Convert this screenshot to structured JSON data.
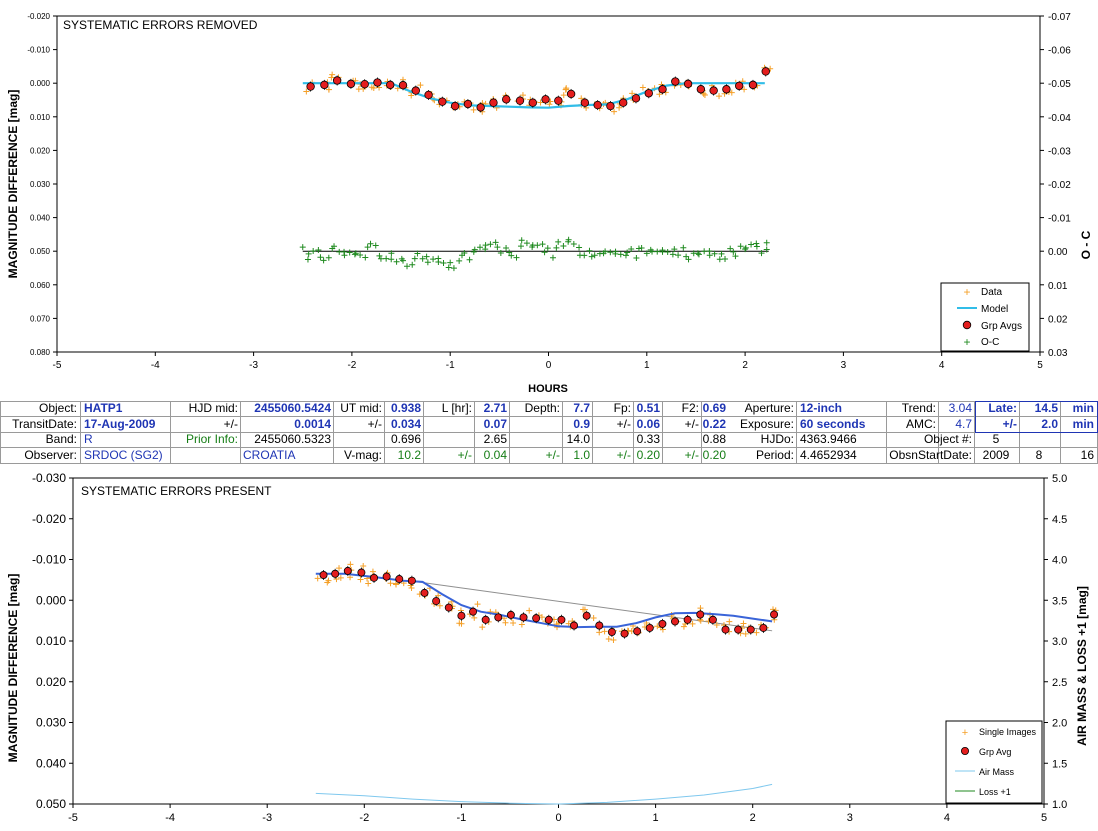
{
  "chart_data": [
    {
      "type": "scatter",
      "title": "SYSTEMATIC ERRORS REMOVED",
      "xlabel": "HOURS",
      "ylabel": "MAGNITUDE DIFFERENCE [mag]",
      "y2label": "O - C",
      "xlim": [
        -5,
        5
      ],
      "ylim": [
        -0.02,
        0.08
      ],
      "y2lim": [
        -0.07,
        0.03
      ],
      "y_reversed": true,
      "y2_reversed": true,
      "x_ticks": [
        "-5",
        "-4",
        "-3",
        "-2",
        "-1",
        "0",
        "1",
        "2",
        "3",
        "4",
        "5"
      ],
      "y_ticks": [
        "-0.020",
        "-0.010",
        "0.000",
        "0.010",
        "0.020",
        "0.030",
        "0.040",
        "0.050",
        "0.060",
        "0.070",
        "0.080"
      ],
      "y2_ticks": [
        "-0.07",
        "-0.06",
        "-0.05",
        "-0.04",
        "-0.03",
        "-0.02",
        "-0.01",
        "0.00",
        "0.01",
        "0.02",
        "0.03"
      ],
      "legend": [
        "Data",
        "Model",
        "Grp Avgs",
        "O-C"
      ],
      "legend_position": "bottom-right",
      "colors": {
        "data": "#f5a028",
        "model": "#31bde8",
        "grp": "#e41e1e",
        "oc": "#1f8a1f"
      },
      "model": {
        "x": [
          -2.5,
          -2.2,
          -1.9,
          -1.6,
          -1.4,
          -1.2,
          -1.0,
          -0.8,
          -0.6,
          -0.4,
          -0.2,
          0.0,
          0.2,
          0.4,
          0.6,
          0.8,
          1.0,
          1.2,
          1.4,
          1.6,
          1.8,
          2.0,
          2.2
        ],
        "y": [
          0.0,
          0.0,
          0.0,
          0.0,
          0.0025,
          0.0045,
          0.0058,
          0.0066,
          0.0068,
          0.007,
          0.0072,
          0.0073,
          0.0068,
          0.0065,
          0.0063,
          0.0048,
          0.0025,
          0.0007,
          0.0,
          0.0,
          0.0,
          0.0,
          0.0
        ]
      },
      "grp_avgs": {
        "x": [
          -2.42,
          -2.28,
          -2.15,
          -2.01,
          -1.87,
          -1.74,
          -1.61,
          -1.48,
          -1.35,
          -1.22,
          -1.08,
          -0.95,
          -0.82,
          -0.69,
          -0.56,
          -0.43,
          -0.29,
          -0.16,
          -0.03,
          0.1,
          0.23,
          0.37,
          0.5,
          0.63,
          0.76,
          0.89,
          1.02,
          1.16,
          1.29,
          1.42,
          1.55,
          1.68,
          1.81,
          1.94,
          2.08,
          2.21
        ],
        "y": [
          0.001,
          0.0005,
          -0.0008,
          0.0002,
          0.0003,
          -0.0002,
          0.0005,
          0.0006,
          0.0022,
          0.0035,
          0.0055,
          0.0068,
          0.0062,
          0.0072,
          0.0058,
          0.0048,
          0.0052,
          0.0058,
          0.0048,
          0.0052,
          0.0032,
          0.0058,
          0.0065,
          0.0068,
          0.0058,
          0.0045,
          0.003,
          0.0018,
          -0.0005,
          0.0002,
          0.0018,
          0.0022,
          0.0018,
          0.0008,
          0.0005,
          -0.0035
        ]
      },
      "oc": {
        "x": [
          -2.44,
          -2.32,
          -2.2,
          -2.08,
          -1.96,
          -1.84,
          -1.72,
          -1.6,
          -1.48,
          -1.36,
          -1.24,
          -1.12,
          -1.0,
          -0.88,
          -0.76,
          -0.64,
          -0.52,
          -0.4,
          -0.28,
          -0.16,
          -0.04,
          0.08,
          0.2,
          0.32,
          0.44,
          0.56,
          0.68,
          0.8,
          0.92,
          1.04,
          1.16,
          1.28,
          1.4,
          1.52,
          1.64,
          1.76,
          1.88,
          2.0,
          2.12,
          2.22
        ],
        "y": [
          0.0008,
          0.0018,
          -0.0008,
          0.0002,
          0.0006,
          -0.0012,
          0.0014,
          0.0024,
          0.0028,
          0.0022,
          0.0016,
          0.0032,
          0.0034,
          0.0012,
          0.0002,
          -0.0018,
          -0.0012,
          0.0004,
          -0.0015,
          -0.0018,
          0.0003,
          -0.001,
          -0.0028,
          0.0012,
          0.0016,
          0.0006,
          0.0008,
          0.0004,
          -0.0008,
          -0.0004,
          0.0002,
          -0.0006,
          0.0016,
          0.0006,
          0.0012,
          0.0008,
          0.0002,
          -0.0006,
          -0.0014,
          -0.0005
        ]
      }
    },
    {
      "type": "scatter",
      "title": "SYSTEMATIC ERRORS PRESENT",
      "ylabel": "MAGNITUDE DIFFERENCE [mag]",
      "y2label": "AIR MASS & LOSS +1 [mag]",
      "xlim": [
        -5,
        5
      ],
      "ylim": [
        -0.03,
        0.05
      ],
      "y2lim": [
        1.0,
        5.0
      ],
      "y_reversed": true,
      "x_ticks": [
        "-5",
        "-4",
        "-3",
        "-2",
        "-1",
        "0",
        "1",
        "2",
        "3",
        "4",
        "5"
      ],
      "y_ticks": [
        "-0.030",
        "-0.020",
        "-0.010",
        "0.000",
        "0.010",
        "0.020",
        "0.030",
        "0.040",
        "0.050"
      ],
      "y2_ticks": [
        "5.0",
        "4.5",
        "4.0",
        "3.5",
        "3.0",
        "2.5",
        "2.0",
        "1.5",
        "1.0"
      ],
      "legend": [
        "Single Images",
        "Grp Avg",
        "Air Mass",
        "Loss +1"
      ],
      "legend_position": "bottom-right",
      "colors": {
        "single": "#f5a028",
        "grp": "#e41e1e",
        "model": "#3a64d8",
        "trend": "#8f8f8f",
        "airmass": "#7fc8ee",
        "loss": "#1f8a1f"
      },
      "model": {
        "x": [
          -2.5,
          -2.2,
          -1.9,
          -1.6,
          -1.4,
          -1.2,
          -1.0,
          -0.8,
          -0.6,
          -0.4,
          -0.2,
          0.0,
          0.2,
          0.4,
          0.6,
          0.8,
          1.0,
          1.2,
          1.4,
          1.6,
          1.8,
          2.0,
          2.2
        ],
        "y": [
          -0.0065,
          -0.0065,
          -0.0057,
          -0.0048,
          -0.0045,
          -0.0015,
          0.0012,
          0.0028,
          0.0036,
          0.0046,
          0.0055,
          0.0064,
          0.0066,
          0.0065,
          0.0065,
          0.0056,
          0.0042,
          0.0032,
          0.0031,
          0.0034,
          0.0038,
          0.0045,
          0.0052
        ]
      },
      "trend_line": {
        "x": [
          -1.45,
          2.2
        ],
        "y": [
          -0.0045,
          0.0075
        ]
      },
      "grp_avgs": {
        "x": [
          -2.42,
          -2.3,
          -2.17,
          -2.03,
          -1.9,
          -1.77,
          -1.64,
          -1.51,
          -1.38,
          -1.26,
          -1.13,
          -1.0,
          -0.88,
          -0.75,
          -0.62,
          -0.49,
          -0.36,
          -0.23,
          -0.1,
          0.03,
          0.16,
          0.29,
          0.42,
          0.55,
          0.68,
          0.81,
          0.94,
          1.07,
          1.2,
          1.33,
          1.46,
          1.59,
          1.72,
          1.85,
          1.98,
          2.11,
          2.22
        ],
        "y": [
          -0.0062,
          -0.0065,
          -0.0072,
          -0.0068,
          -0.0055,
          -0.0058,
          -0.0052,
          -0.0048,
          -0.0018,
          0.0002,
          0.0018,
          0.0038,
          0.0028,
          0.0048,
          0.0042,
          0.0036,
          0.0042,
          0.0044,
          0.0048,
          0.0048,
          0.0062,
          0.0038,
          0.0062,
          0.0078,
          0.0082,
          0.0076,
          0.0068,
          0.0058,
          0.0052,
          0.0048,
          0.0035,
          0.0048,
          0.0072,
          0.0072,
          0.0072,
          0.0068,
          0.0035
        ]
      },
      "airmass": {
        "x": [
          -2.5,
          -2.0,
          -1.5,
          -1.0,
          -0.5,
          0.0,
          0.5,
          1.0,
          1.5,
          2.0,
          2.2
        ],
        "y": [
          1.13,
          1.1,
          1.06,
          1.03,
          1.01,
          1.0,
          1.02,
          1.06,
          1.11,
          1.19,
          1.24
        ]
      }
    }
  ],
  "info": {
    "row1": {
      "object_label": "Object:",
      "object": "HATP1",
      "hjd_mid_label": "HJD mid:",
      "hjd_mid": "2455060.5424",
      "ut_mid_label": "UT mid:",
      "ut_mid": "0.938",
      "l_hr_label": "L [hr]:",
      "l_hr": "2.71",
      "depth_label": "Depth:",
      "depth": "7.7",
      "fp_label": "Fp:",
      "fp": "0.51",
      "f2_label": "F2:",
      "f2": "0.69",
      "aperture_label": "Aperture:",
      "aperture": "12-inch",
      "trend_label": "Trend:",
      "trend": "3.04",
      "late_label": "Late:",
      "late": "14.5",
      "late_unit": "min"
    },
    "row2": {
      "transit_date_label": "TransitDate:",
      "transit_date": "17-Aug-2009",
      "pm1": "+/-",
      "hjd_err": "0.0014",
      "pm2": "+/-",
      "ut_err": "0.034",
      "l_err": "0.07",
      "depth_err": "0.9",
      "pm3": "+/-",
      "fp_err": "0.06",
      "pm4": "+/-",
      "f2_err": "0.22",
      "exposure_label": "Exposure:",
      "exposure": "60 seconds",
      "amc_label": "AMC:",
      "amc": "4.7",
      "pm5": "+/-",
      "late_err": "2.0",
      "late_err_unit": "min"
    },
    "row3": {
      "band_label": "Band:",
      "band": "R",
      "prior_label": "Prior Info:",
      "prior_hjd": "2455060.5323",
      "prior_ut": "0.696",
      "prior_l": "2.65",
      "prior_depth": "14.0",
      "prior_fp": "0.33",
      "prior_f2": "0.88",
      "hjdo_label": "HJDo:",
      "hjdo": "4363.9466",
      "object_num_label": "Object #:",
      "object_num": "5"
    },
    "row4": {
      "observer_label": "Observer:",
      "observer": "SRDOC (SG2)",
      "country": "CROATIA",
      "vmag_label": "V-mag:",
      "vmag": "10.2",
      "pm6": "+/-",
      "e1": "0.04",
      "pm7": "+/-",
      "e2": "1.0",
      "pm8": "+/-",
      "e3": "0.20",
      "pm9": "+/-",
      "e4": "0.20",
      "period_label": "Period:",
      "period": "4.4652934",
      "obsn_label": "ObsnStartDate:",
      "year": "2009",
      "month": "8",
      "day": "16"
    }
  }
}
